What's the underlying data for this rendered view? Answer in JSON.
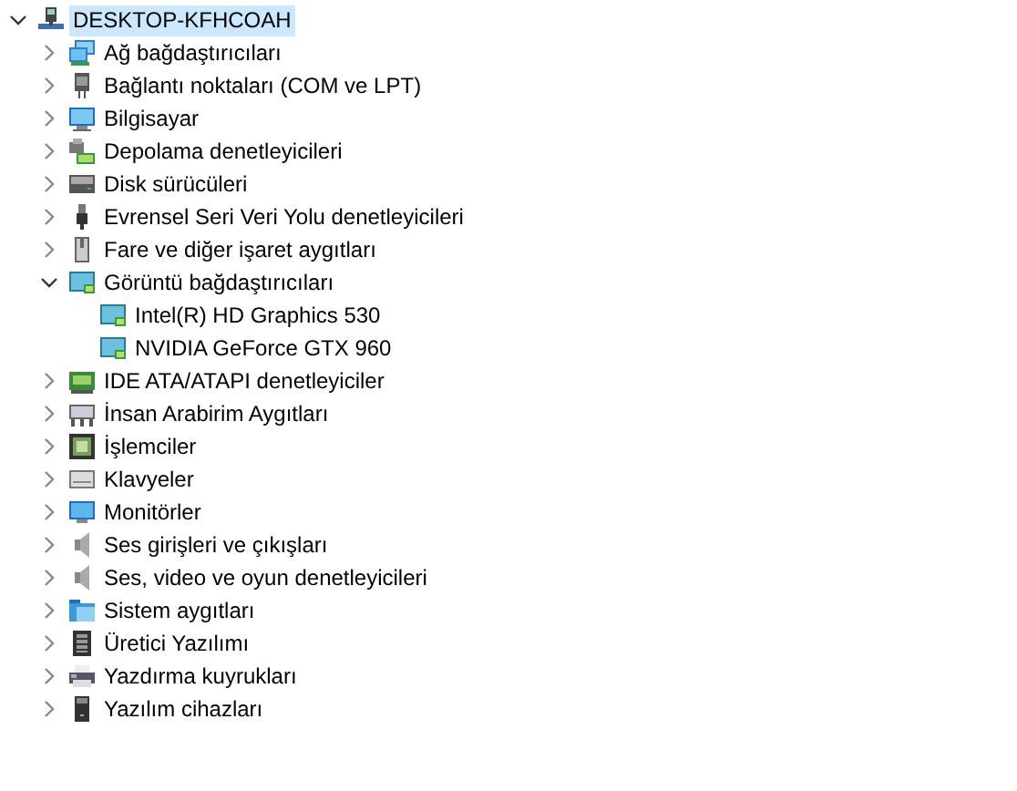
{
  "tree": [
    {
      "label": "DESKTOP-KFHCOAH",
      "kind": "pc",
      "expanded": true,
      "selected": true,
      "children": [
        {
          "label": "Ağ bağdaştırıcıları",
          "kind": "network",
          "expanded": false,
          "selected": false
        },
        {
          "label": "Bağlantı noktaları (COM ve LPT)",
          "kind": "port",
          "expanded": false,
          "selected": false
        },
        {
          "label": "Bilgisayar",
          "kind": "computer",
          "expanded": false,
          "selected": false
        },
        {
          "label": "Depolama denetleyicileri",
          "kind": "storage",
          "expanded": false,
          "selected": false
        },
        {
          "label": "Disk sürücüleri",
          "kind": "disk",
          "expanded": false,
          "selected": false
        },
        {
          "label": "Evrensel Seri Veri Yolu denetleyicileri",
          "kind": "usb",
          "expanded": false,
          "selected": false
        },
        {
          "label": "Fare ve diğer işaret aygıtları",
          "kind": "mouse",
          "expanded": false,
          "selected": false
        },
        {
          "label": "Görüntü bağdaştırıcıları",
          "kind": "display",
          "expanded": true,
          "selected": false,
          "children": [
            {
              "label": "Intel(R) HD Graphics 530",
              "kind": "display",
              "selected": false
            },
            {
              "label": "NVIDIA GeForce GTX 960",
              "kind": "display",
              "selected": false
            }
          ]
        },
        {
          "label": "IDE ATA/ATAPI denetleyiciler",
          "kind": "ide",
          "expanded": false,
          "selected": false
        },
        {
          "label": "İnsan Arabirim Aygıtları",
          "kind": "hid",
          "expanded": false,
          "selected": false
        },
        {
          "label": "İşlemciler",
          "kind": "cpu",
          "expanded": false,
          "selected": false
        },
        {
          "label": "Klavyeler",
          "kind": "keyboard",
          "expanded": false,
          "selected": false
        },
        {
          "label": "Monitörler",
          "kind": "monitor",
          "expanded": false,
          "selected": false
        },
        {
          "label": "Ses girişleri ve çıkışları",
          "kind": "speaker",
          "expanded": false,
          "selected": false
        },
        {
          "label": "Ses, video ve oyun denetleyicileri",
          "kind": "speaker",
          "expanded": false,
          "selected": false
        },
        {
          "label": "Sistem aygıtları",
          "kind": "system",
          "expanded": false,
          "selected": false
        },
        {
          "label": "Üretici Yazılımı",
          "kind": "firmware",
          "expanded": false,
          "selected": false
        },
        {
          "label": "Yazdırma kuyrukları",
          "kind": "printer",
          "expanded": false,
          "selected": false
        },
        {
          "label": "Yazılım cihazları",
          "kind": "software",
          "expanded": false,
          "selected": false
        }
      ]
    }
  ]
}
